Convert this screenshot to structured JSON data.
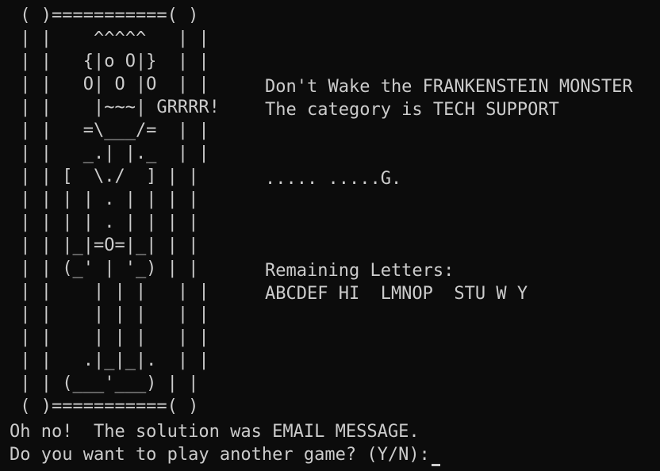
{
  "monster_art": [
    " ( )===========( )",
    " | |    ^^^^^   | |",
    " | |   {|o O|}  | |",
    " | |   O| O |O  | |",
    " | |    |~~~| GRRRR!",
    " | |   =\\___/=  | |",
    " | |   _.| |._  | |",
    " | | [  \\./  ] | |",
    " | | | | . | | | |",
    " | | | | . | | | |",
    " | | |_|=O=|_| | |",
    " | | (_' | '_) | |",
    " | |    | | |   | |",
    " | |    | | |   | |",
    " | |    | | |   | |",
    " | |   .|_|_|.  | |",
    " | | (___'___) | |",
    " ( )===========( )"
  ],
  "info": {
    "title": "Don't Wake the FRANKENSTEIN MONSTER",
    "category": "The category is TECH SUPPORT",
    "puzzle": "..... .....G.",
    "remaining_label": "Remaining Letters:",
    "remaining_letters": "ABCDEF HI  LMNOP  STU W Y"
  },
  "footer": {
    "solution": "Oh no!  The solution was EMAIL MESSAGE.",
    "prompt": "Do you want to play another game? (Y/N):"
  }
}
